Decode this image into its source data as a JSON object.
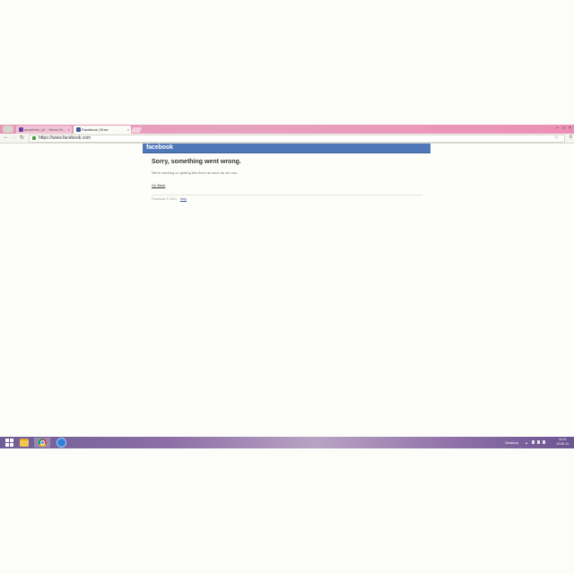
{
  "browser": {
    "tabs": [
      {
        "label": "andrebbe_s2 - Yahoo M..."
      },
      {
        "label": "Facebook | Error"
      }
    ],
    "url": "https://www.facebook.com"
  },
  "page": {
    "logo": "facebook",
    "title": "Sorry, something went wrong.",
    "message": "We're working on getting this fixed as soon as we can.",
    "go_back": "Go Back",
    "footer": "Facebook © 2013 ·",
    "help": "Help"
  },
  "taskbar": {
    "desktop_label": "Desktop",
    "tray_arrow": "▴",
    "time": "11:01",
    "date": "20.06.13"
  },
  "colors": {
    "fb_blue": "#4e78b8",
    "titlebar_pink": "#e896b8",
    "taskbar_purple": "#8d6fa6"
  }
}
